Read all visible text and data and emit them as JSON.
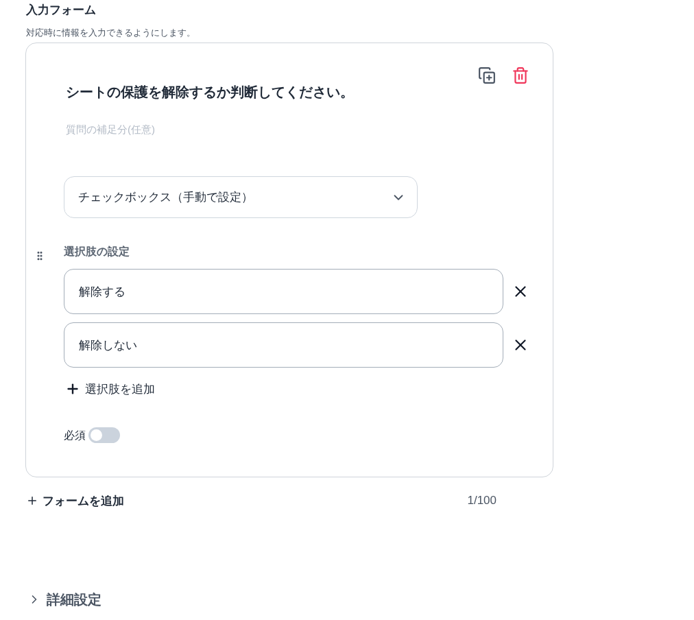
{
  "section": {
    "title": "入力フォーム",
    "description": "対応時に情報を入力できるようにします。"
  },
  "form_card": {
    "question": "シートの保護を解除するか判断してください。",
    "supplement": {
      "placeholder": "質問の補足分(任意)"
    },
    "answer_type": {
      "value": "チェックボックス（手動で設定）"
    },
    "choices_label": "選択肢の設定",
    "choices": [
      {
        "value": "解除する"
      },
      {
        "value": "解除しない"
      }
    ],
    "add_choice": "選択肢を追加",
    "required": {
      "label": "必須",
      "on": false
    }
  },
  "footer": {
    "add_form": "フォームを追加",
    "count": "1/100"
  },
  "details": {
    "label": "詳細設定",
    "expanded": false
  }
}
